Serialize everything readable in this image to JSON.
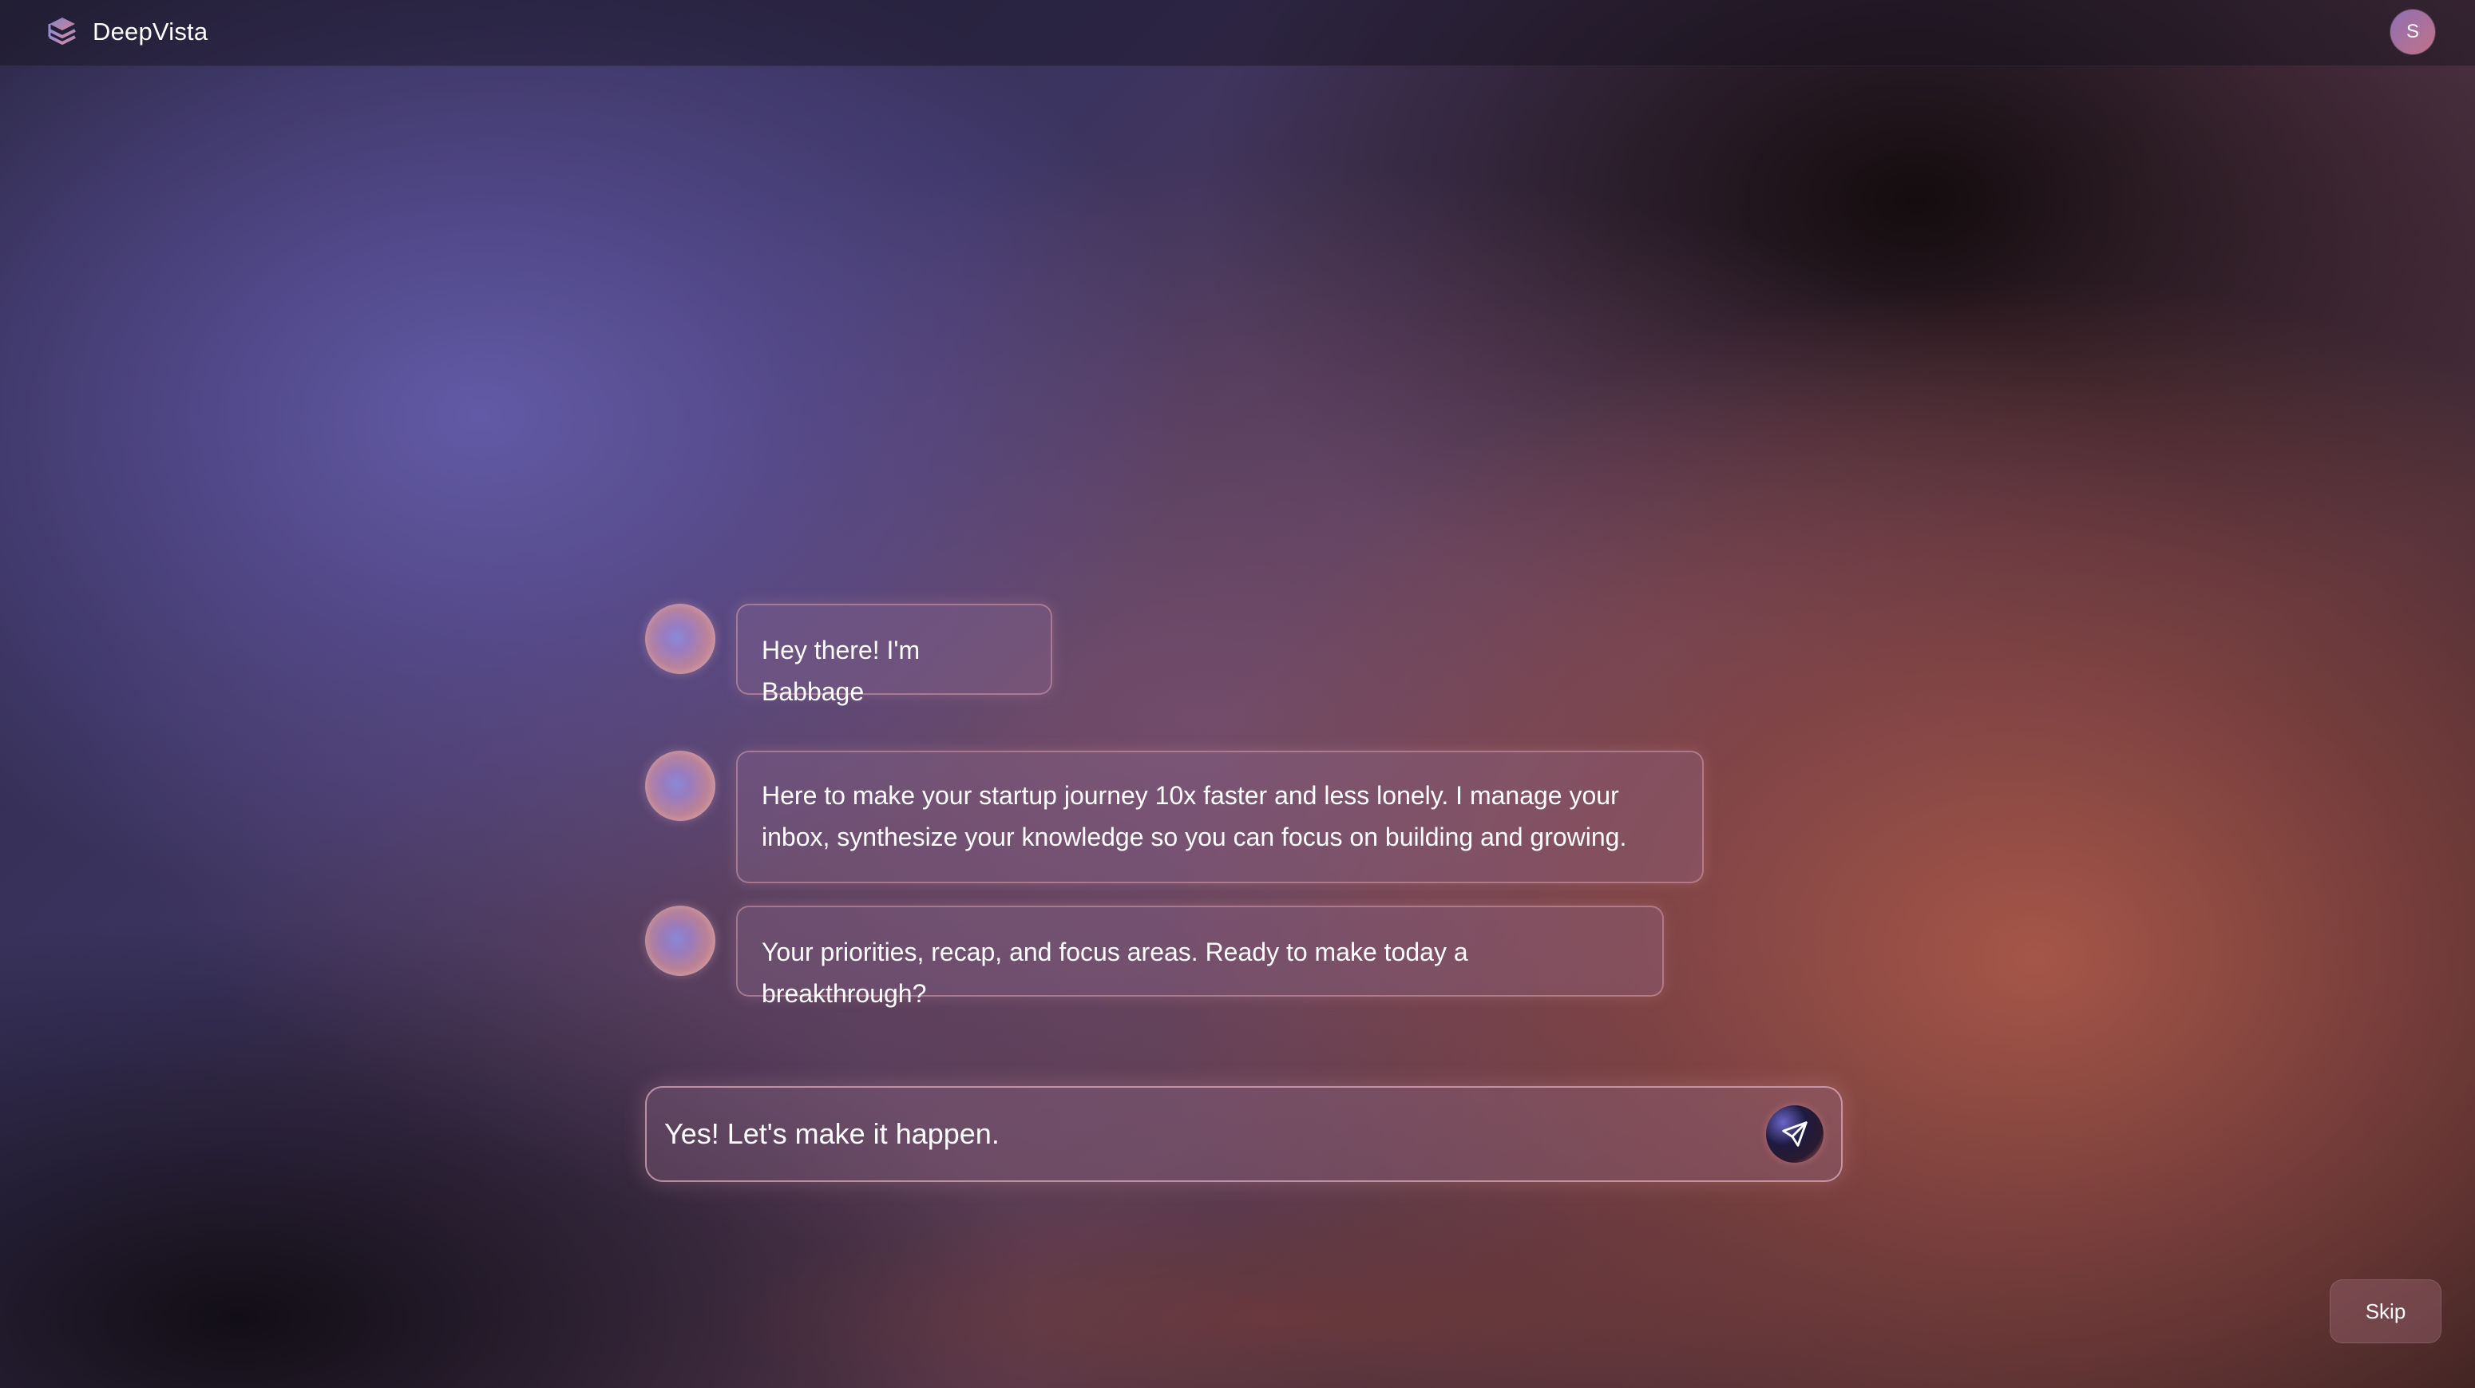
{
  "app": {
    "name": "DeepVista",
    "user_initial": "S"
  },
  "chat": {
    "messages": [
      {
        "sender": "Babbage",
        "text": "Hey there! I'm Babbage"
      },
      {
        "sender": "Babbage",
        "text": "Here to make your startup journey 10x faster and less lonely. I manage your inbox, synthesize your knowledge so you can focus on building and growing."
      },
      {
        "sender": "Babbage",
        "text": "Your priorities, recap, and focus areas. Ready to make today a breakthrough?"
      }
    ],
    "input_value": "Yes! Let's make it happen.",
    "send_icon": "send-icon"
  },
  "footer": {
    "skip_label": "Skip"
  },
  "colors": {
    "accent_purple": "#5c5aa0",
    "accent_coral": "#a85a4c",
    "bubble_border": "#e6aab4"
  }
}
